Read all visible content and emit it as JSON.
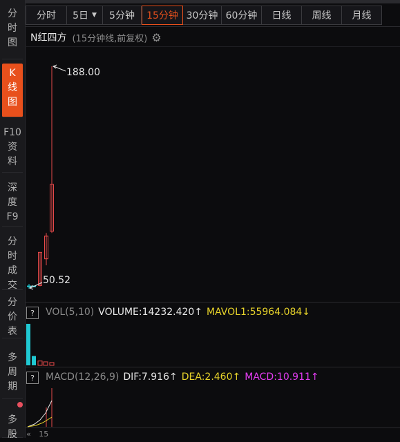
{
  "sidebar": {
    "items": [
      {
        "label": "分时图",
        "lines": [
          "分",
          "时",
          "图"
        ],
        "active": false
      },
      {
        "label": "K线图",
        "lines": [
          "K",
          "线",
          "图"
        ],
        "active": true
      },
      {
        "label": "F10资料",
        "lines": [
          "F10",
          "资",
          "料"
        ],
        "active": false
      },
      {
        "label": "深度F9",
        "lines": [
          "深",
          "度",
          "F9"
        ],
        "active": false
      },
      {
        "label": "分时成交",
        "lines": [
          "分",
          "时",
          "成",
          "交"
        ],
        "active": false
      },
      {
        "label": "分价表",
        "lines": [
          "分",
          "价",
          "表"
        ],
        "active": false
      },
      {
        "label": "多周期",
        "lines": [
          "多",
          "周",
          "期"
        ],
        "active": false
      },
      {
        "label": "多股",
        "lines": [
          "多",
          "股"
        ],
        "active": false
      }
    ]
  },
  "tabs": [
    {
      "label": "分时",
      "active": false
    },
    {
      "label": "5日",
      "active": false,
      "dropdown": true
    },
    {
      "label": "5分钟",
      "active": false
    },
    {
      "label": "15分钟",
      "active": true
    },
    {
      "label": "30分钟",
      "active": false
    },
    {
      "label": "60分钟",
      "active": false
    },
    {
      "label": "日线",
      "active": false
    },
    {
      "label": "周线",
      "active": false
    },
    {
      "label": "月线",
      "active": false
    }
  ],
  "header": {
    "stock_name": "N红四方",
    "period_label": "(15分钟线,前复权)",
    "settings_icon": "gear-icon"
  },
  "kline": {
    "high_label": "188.00",
    "low_label": "50.52",
    "high": 188.0,
    "low": 50.52,
    "candles": [
      {
        "open": 52.0,
        "close": 52.2,
        "high": 53.5,
        "low": 50.52
      },
      {
        "open": 51.8,
        "close": 52.1,
        "high": 52.5,
        "low": 51.6
      },
      {
        "open": 52.5,
        "close": 73.0,
        "high": 73.0,
        "low": 52.0
      },
      {
        "open": 69.0,
        "close": 83.0,
        "high": 85.0,
        "low": 65.0
      },
      {
        "open": 86.0,
        "close": 115.0,
        "high": 188.0,
        "low": 85.0
      }
    ]
  },
  "volume": {
    "indicator_name": "VOL(5,10)",
    "volume_text": "VOLUME:14232.420",
    "volume_dir": "↑",
    "mavol_text": "MAVOL1:55964.084",
    "mavol_dir": "↓",
    "bars": [
      62000,
      14000,
      6500,
      5200,
      4200
    ]
  },
  "macd": {
    "indicator_name": "MACD(12,26,9)",
    "dif_text": "DIF:7.916",
    "dif_dir": "↑",
    "dea_text": "DEA:2.460",
    "dea_dir": "↑",
    "macd_text": "MACD:10.911",
    "macd_dir": "↑"
  },
  "footer": {
    "scroll_left_icon": "double-left-icon",
    "partial_label": "15"
  },
  "colors": {
    "accent": "#e8501c",
    "up": "#e84a4a",
    "down": "#20c8d2",
    "dif": "#e6e6e6",
    "dea": "#e6d22a",
    "macd": "#e23cf0"
  }
}
